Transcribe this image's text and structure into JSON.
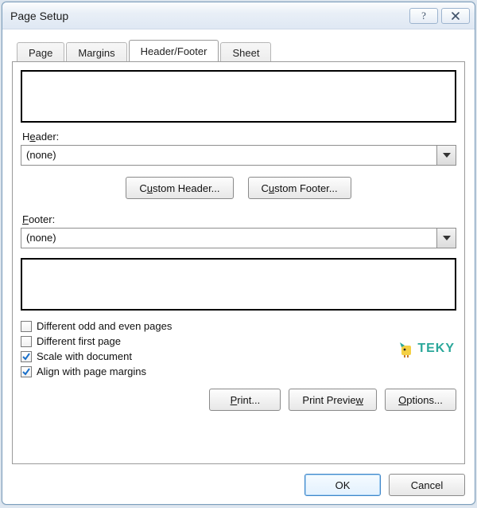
{
  "window": {
    "title": "Page Setup"
  },
  "tabs": {
    "page": "Page",
    "margins": "Margins",
    "header_footer": "Header/Footer",
    "sheet": "Sheet"
  },
  "header_section": {
    "label_pre": "H",
    "label_ul": "e",
    "label_post": "ader:",
    "value": "(none)"
  },
  "footer_section": {
    "label_ul": "F",
    "label_post": "ooter:",
    "value": "(none)"
  },
  "buttons": {
    "custom_header_pre": "C",
    "custom_header_ul": "u",
    "custom_header_post": "stom Header...",
    "custom_footer_pre": "C",
    "custom_footer_ul": "u",
    "custom_footer_post": "stom Footer...",
    "print_ul": "P",
    "print_post": "rint...",
    "preview_pre": "Print Previe",
    "preview_ul": "w",
    "options_ul": "O",
    "options_post": "ptions...",
    "ok": "OK",
    "cancel": "Cancel"
  },
  "checks": {
    "diff_odd_even": {
      "pre": "",
      "ul": "D",
      "post": "ifferent odd and even pages",
      "checked": false
    },
    "diff_first": {
      "pre": "D",
      "ul": "i",
      "post": "fferent first page",
      "checked": false
    },
    "scale_doc": {
      "pre": "Sca",
      "ul": "l",
      "post": "e with document",
      "checked": true
    },
    "align_margins": {
      "pre": "Align with page ",
      "ul": "m",
      "post": "argins",
      "checked": true
    }
  },
  "logo_text": "TEKY"
}
